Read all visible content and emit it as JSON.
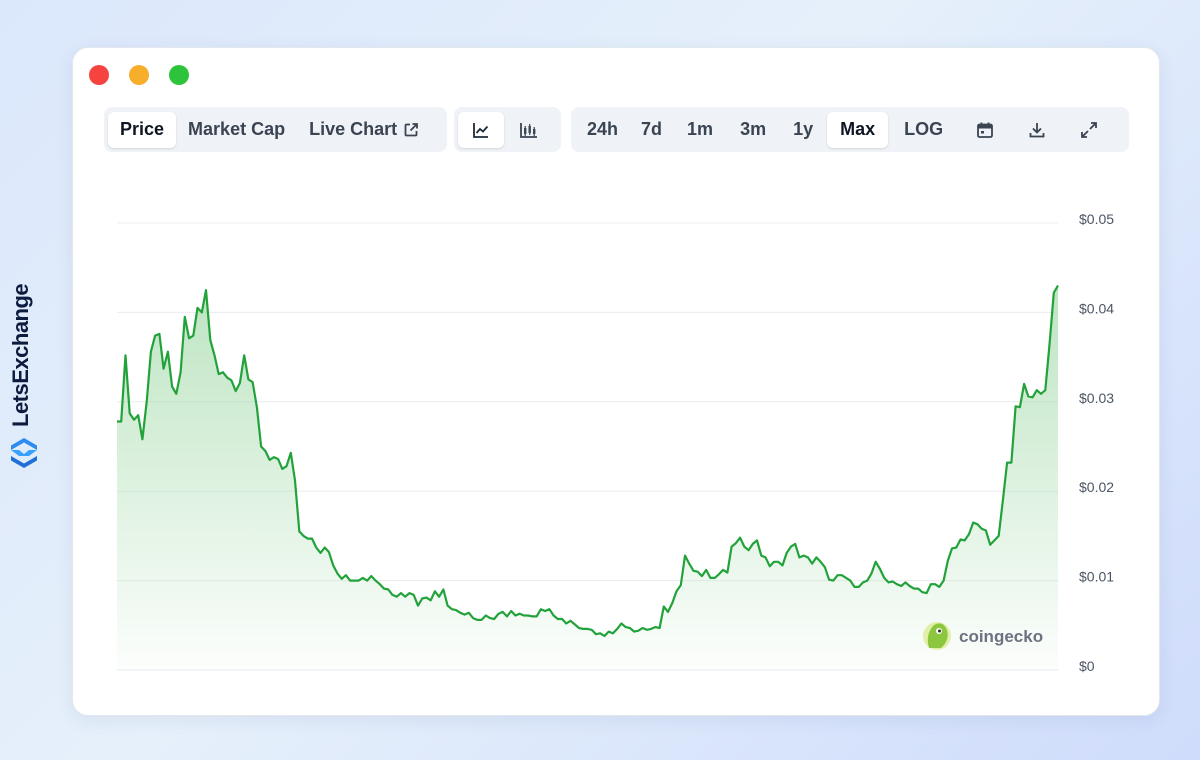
{
  "brand": {
    "name": "LetsExchange"
  },
  "toolbar": {
    "view_tabs": [
      {
        "label": "Price",
        "active": true
      },
      {
        "label": "Market Cap",
        "active": false
      },
      {
        "label": "Live Chart",
        "active": false
      }
    ],
    "chart_styles": [
      {
        "icon": "line-chart-icon",
        "active": true
      },
      {
        "icon": "candlestick-chart-icon",
        "active": false
      }
    ],
    "ranges": [
      {
        "label": "24h",
        "active": false
      },
      {
        "label": "7d",
        "active": false
      },
      {
        "label": "1m",
        "active": false
      },
      {
        "label": "3m",
        "active": false
      },
      {
        "label": "1y",
        "active": false
      },
      {
        "label": "Max",
        "active": true
      },
      {
        "label": "LOG",
        "active": false
      }
    ],
    "tools": [
      "calendar-icon",
      "download-icon",
      "expand-icon"
    ]
  },
  "colors": {
    "line": "#22a23a",
    "fill_top": "#a8dcae",
    "grid": "#e9ecf0",
    "close": "#f5443f",
    "minimize": "#f6ae2b",
    "maximize": "#2dc43b"
  },
  "watermark": {
    "text": "coingecko"
  },
  "chart_data": {
    "type": "area",
    "title": "",
    "xlabel": "",
    "ylabel": "",
    "ylim": [
      0,
      0.05
    ],
    "y_ticks": [
      0,
      0.01,
      0.02,
      0.03,
      0.04,
      0.05
    ],
    "y_tick_labels": [
      "$0",
      "$0.01",
      "$0.02",
      "$0.03",
      "$0.04",
      "$0.05"
    ],
    "grid": true,
    "series": [
      {
        "values": [
          0.0278,
          0.0278,
          0.0352,
          0.0287,
          0.028,
          0.0285,
          0.0258,
          0.03,
          0.0356,
          0.0374,
          0.0376,
          0.0337,
          0.0356,
          0.0317,
          0.0309,
          0.0333,
          0.0395,
          0.0371,
          0.0374,
          0.0405,
          0.04,
          0.0425,
          0.0369,
          0.0352,
          0.0331,
          0.0333,
          0.0327,
          0.0324,
          0.0312,
          0.0321,
          0.0352,
          0.0325,
          0.0322,
          0.0294,
          0.025,
          0.0245,
          0.0235,
          0.0238,
          0.0236,
          0.0225,
          0.0228,
          0.0243,
          0.0212,
          0.0155,
          0.015,
          0.0147,
          0.0147,
          0.0137,
          0.0131,
          0.0137,
          0.0132,
          0.0117,
          0.0108,
          0.0102,
          0.0106,
          0.01,
          0.01,
          0.01,
          0.0103,
          0.01,
          0.0105,
          0.01,
          0.0096,
          0.0091,
          0.009,
          0.0084,
          0.0082,
          0.0086,
          0.0082,
          0.0086,
          0.0084,
          0.0072,
          0.008,
          0.0081,
          0.0078,
          0.0088,
          0.0082,
          0.009,
          0.0072,
          0.0068,
          0.0067,
          0.0064,
          0.0062,
          0.0064,
          0.0058,
          0.0056,
          0.0056,
          0.0061,
          0.0058,
          0.0057,
          0.0063,
          0.0065,
          0.006,
          0.0066,
          0.0061,
          0.0063,
          0.0061,
          0.0061,
          0.006,
          0.006,
          0.0068,
          0.0066,
          0.0068,
          0.0061,
          0.0057,
          0.0057,
          0.0052,
          0.0055,
          0.0051,
          0.0047,
          0.0046,
          0.0046,
          0.0045,
          0.004,
          0.0041,
          0.0038,
          0.0043,
          0.0041,
          0.0046,
          0.0052,
          0.0048,
          0.0047,
          0.0043,
          0.0044,
          0.0047,
          0.0045,
          0.0046,
          0.0048,
          0.0047,
          0.0071,
          0.0065,
          0.0075,
          0.0088,
          0.0095,
          0.0128,
          0.0119,
          0.0111,
          0.011,
          0.0105,
          0.0112,
          0.0103,
          0.0103,
          0.0107,
          0.0112,
          0.0109,
          0.0138,
          0.0142,
          0.0148,
          0.0138,
          0.0134,
          0.0141,
          0.0145,
          0.0128,
          0.0126,
          0.0116,
          0.0121,
          0.0121,
          0.0117,
          0.0131,
          0.0138,
          0.0141,
          0.0126,
          0.0128,
          0.0126,
          0.0119,
          0.0126,
          0.0121,
          0.0115,
          0.0101,
          0.01,
          0.0106,
          0.0106,
          0.0103,
          0.01,
          0.0093,
          0.0093,
          0.0098,
          0.01,
          0.0108,
          0.0121,
          0.0113,
          0.0103,
          0.0098,
          0.0099,
          0.0096,
          0.0094,
          0.0098,
          0.0094,
          0.0091,
          0.0091,
          0.0087,
          0.0086,
          0.0096,
          0.0096,
          0.0093,
          0.01,
          0.0122,
          0.0136,
          0.0137,
          0.0146,
          0.0145,
          0.0152,
          0.0165,
          0.0163,
          0.0158,
          0.0156,
          0.014,
          0.0145,
          0.015,
          0.019,
          0.0232,
          0.0232,
          0.0295,
          0.0294,
          0.032,
          0.0306,
          0.0305,
          0.0313,
          0.0309,
          0.0313,
          0.0364,
          0.0422,
          0.043
        ]
      }
    ]
  }
}
